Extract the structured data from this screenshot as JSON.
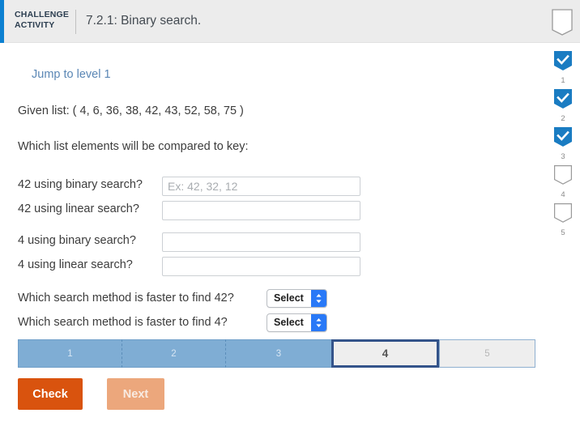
{
  "header": {
    "challenge_label": "CHALLENGE ACTIVITY",
    "title": "7.2.1: Binary search.",
    "bookmark_icon": "bookmark-outline-icon",
    "accent_color": "#0c80d1"
  },
  "main": {
    "jump_link": "Jump to level 1",
    "given_list": "Given list: ( 4, 6, 36, 38, 42, 43, 52, 58, 75 )",
    "prompt": "Which list elements will be compared to key:",
    "text_questions": [
      {
        "label": "42 using binary search?",
        "value": "",
        "placeholder": "Ex: 42, 32, 12"
      },
      {
        "label": "42 using linear search?",
        "value": "",
        "placeholder": ""
      },
      {
        "label": "4 using binary search?",
        "value": "",
        "placeholder": ""
      },
      {
        "label": "4 using linear search?",
        "value": "",
        "placeholder": ""
      }
    ],
    "select_questions": [
      {
        "label": "Which search method is faster to find 42?",
        "selected": "Select"
      },
      {
        "label": "Which search method is faster to find 4?",
        "selected": "Select"
      }
    ]
  },
  "progress": {
    "segments": [
      {
        "label": "1",
        "state": "done"
      },
      {
        "label": "2",
        "state": "done"
      },
      {
        "label": "3",
        "state": "done"
      },
      {
        "label": "4",
        "state": "active"
      },
      {
        "label": "5",
        "state": "upcoming"
      }
    ],
    "done_color": "#7fadd4",
    "active_border_color": "#33538a"
  },
  "buttons": {
    "check": "Check",
    "next": "Next",
    "check_color": "#d9530e",
    "next_color": "#eca77c"
  },
  "rail": {
    "items": [
      {
        "number": "1",
        "checked": true
      },
      {
        "number": "2",
        "checked": true
      },
      {
        "number": "3",
        "checked": true
      },
      {
        "number": "4",
        "checked": false
      },
      {
        "number": "5",
        "checked": false
      }
    ],
    "checked_color": "#1a7cc2"
  }
}
